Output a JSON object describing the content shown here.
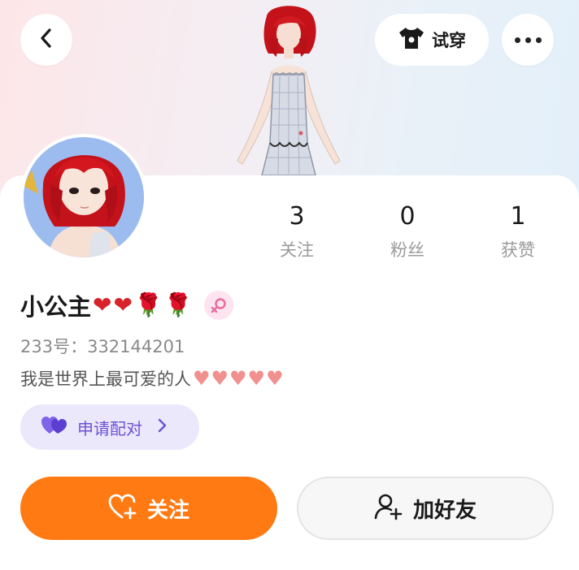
{
  "header": {
    "tryon_label": "试穿"
  },
  "stats": [
    {
      "value": "3",
      "label": "关注"
    },
    {
      "value": "0",
      "label": "粉丝"
    },
    {
      "value": "1",
      "label": "获赞"
    }
  ],
  "profile": {
    "name": "小公主",
    "name_emojis": [
      "❤",
      "❤",
      "🌹",
      "🌹"
    ],
    "gender": "female",
    "id_line": "233号：332144201",
    "bio": "我是世界上最可爱的人",
    "bio_hearts": "♥♥♥♥♥"
  },
  "pair_button": {
    "label": "申请配对"
  },
  "actions": {
    "follow_label": "关注",
    "add_friend_label": "加好友"
  },
  "colors": {
    "accent_orange": "#ff7a12",
    "pair_purple": "#6b52d6",
    "pair_bg": "#ece8fb",
    "gender_pink": "#e86a9e"
  },
  "icons": {
    "back": "chevron-left-icon",
    "tryon": "tshirt-icon",
    "more": "more-dots-icon",
    "pair": "double-heart-icon",
    "follow": "heart-plus-icon",
    "add_friend": "user-plus-icon"
  }
}
